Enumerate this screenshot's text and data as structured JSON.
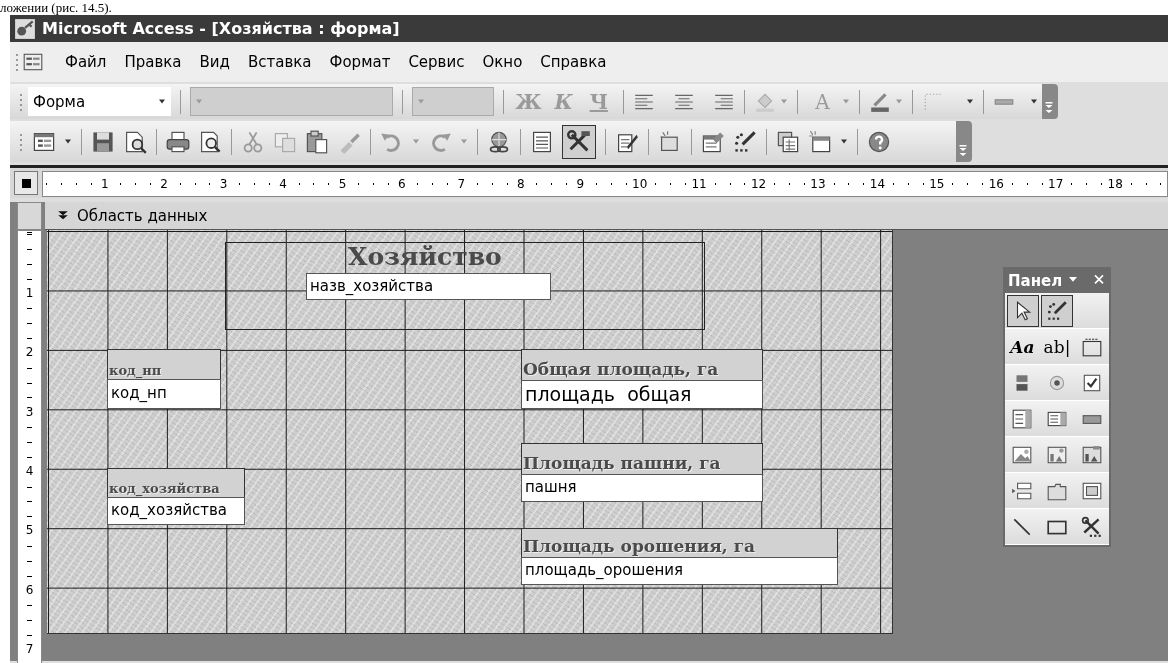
{
  "page_text": "ложении (рис. 14.5).",
  "window": {
    "title": "Microsoft Access - [Хозяйства : форма]"
  },
  "menu": [
    "Файл",
    "Правка",
    "Вид",
    "Вставка",
    "Формат",
    "Сервис",
    "Окно",
    "Справка"
  ],
  "formatting_toolbar": {
    "object_box": {
      "value": "Форма"
    },
    "font_box": {
      "disabled": true
    },
    "size_box": {
      "disabled": true
    },
    "style_buttons": [
      {
        "label": "Ж",
        "disabled": true
      },
      {
        "label": "К",
        "disabled": true
      },
      {
        "label": "Ч",
        "disabled": true
      }
    ],
    "font_color_button": {
      "label": "A",
      "disabled": true
    }
  },
  "standard_toolbar": {
    "toolbox_pressed": true
  },
  "ruler": {
    "marks": [
      "1",
      "2",
      "3",
      "4",
      "5",
      "6",
      "7",
      "8",
      "9",
      "10",
      "11",
      "12",
      "13",
      "14",
      "15",
      "16",
      "17",
      "18"
    ]
  },
  "vertical_ruler": {
    "marks": [
      "1",
      "2",
      "3",
      "4",
      "5",
      "6",
      "7"
    ]
  },
  "section": {
    "title": "Область данных"
  },
  "controls": [
    {
      "kind": "title",
      "text": "Хозяйство"
    },
    {
      "kind": "field",
      "text": "назв_хозяйства"
    },
    {
      "kind": "caption",
      "text": "код_нп"
    },
    {
      "kind": "field",
      "text": "код_нп"
    },
    {
      "kind": "caption",
      "text": "Общая площадь, га"
    },
    {
      "kind": "field",
      "text": "площадь  общая"
    },
    {
      "kind": "caption",
      "text": "Площадь пашни, га"
    },
    {
      "kind": "field",
      "text": "пашня"
    },
    {
      "kind": "caption",
      "text": "код_хозяйства"
    },
    {
      "kind": "field",
      "text": "код_хозяйства"
    },
    {
      "kind": "caption",
      "text": "Площадь орошения, га"
    },
    {
      "kind": "field",
      "text": "площадь_орошения"
    }
  ],
  "toolbox": {
    "title": "Панел",
    "select_pressed": true,
    "wizard_pressed": true,
    "label_tool": "Aa",
    "textbox_tool": "ab|"
  }
}
